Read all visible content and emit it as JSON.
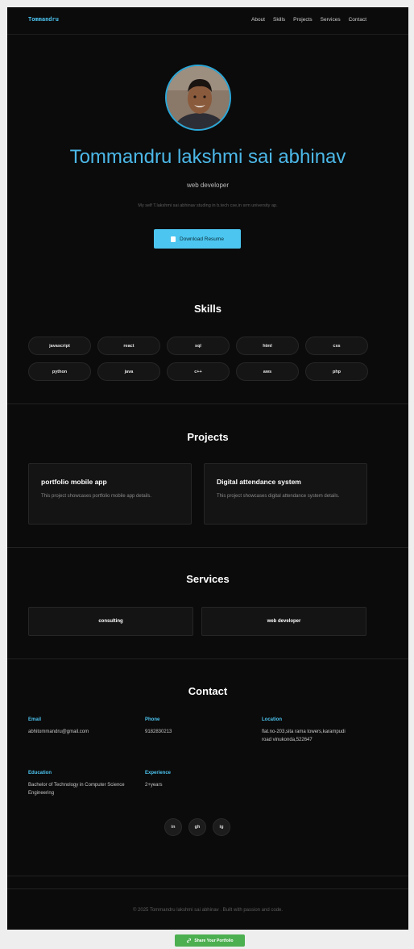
{
  "nav": {
    "logo": "Tommandru",
    "links": [
      "About",
      "Skills",
      "Projects",
      "Services",
      "Contact"
    ]
  },
  "hero": {
    "name": "Tommandru lakshmi sai abhinav",
    "role": "web developer",
    "bio": "My self T.lakshmi sai abhinav studing in b.tech cse,in srm university ap.",
    "resume_button": "Download Resume"
  },
  "skills": {
    "title": "Skills",
    "items": [
      "javascript",
      "react",
      "sql",
      "html",
      "css",
      "python",
      "java",
      "c++",
      "aws",
      "php"
    ]
  },
  "projects": {
    "title": "Projects",
    "items": [
      {
        "title": "portfolio mobile app",
        "description": "This project showcases portfolio mobile app details."
      },
      {
        "title": "Digital attendance system",
        "description": "This project showcases digital attendance system details."
      }
    ]
  },
  "services": {
    "title": "Services",
    "items": [
      "consulting",
      "web developer"
    ]
  },
  "contact": {
    "title": "Contact",
    "email": {
      "label": "Email",
      "value": "abhitommandru@gmail.com"
    },
    "phone": {
      "label": "Phone",
      "value": "9182830213"
    },
    "location": {
      "label": "Location",
      "value": "flat.no-203,sita rama towers,karampudi road vinukonda,522647"
    },
    "education": {
      "label": "Education",
      "value": "Bachelor of Technology in Computer Science Engineering"
    },
    "experience": {
      "label": "Experience",
      "value": "2+years"
    },
    "socials": [
      "in",
      "gh",
      "ig"
    ]
  },
  "footer": {
    "text": "© 2025 Tommandru lakshmi sai abhinav . Built with passion and code."
  },
  "share_button": "Share Your Portfolio",
  "colors": {
    "accent": "#4cc3ee",
    "background": "#0b0b0b",
    "share": "#4caf50"
  }
}
